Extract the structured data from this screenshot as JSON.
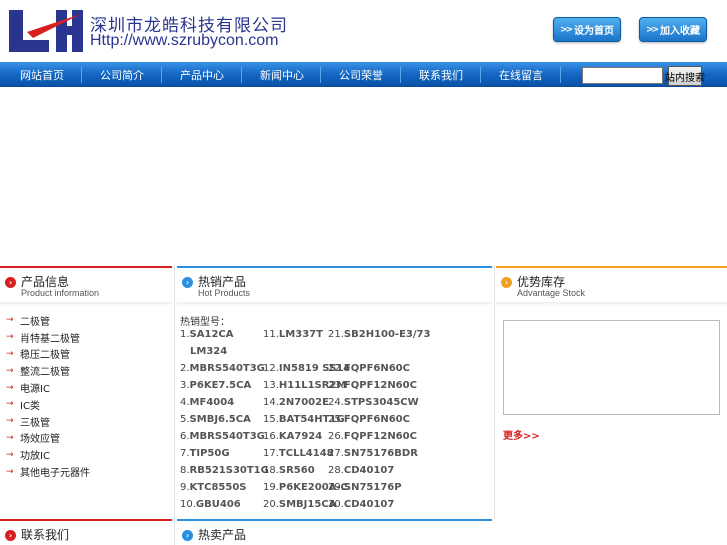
{
  "header": {
    "company_name": "深圳市龙皓科技有限公司",
    "url": "Http://www.szrubycon.com",
    "set_home_label": "设为首页",
    "add_favorite_label": "加入收藏",
    "logo_color": "#2a3590",
    "logo_accent": "#d6201f"
  },
  "nav": {
    "items": [
      "网站首页",
      "公司简介",
      "产品中心",
      "新闻中心",
      "公司荣誉",
      "联系我们",
      "在线留言"
    ],
    "search_button": "站内搜索"
  },
  "panels": {
    "product": {
      "title": "产品信息",
      "subtitle": "Product information"
    },
    "hot": {
      "title": "热销产品",
      "subtitle": "Hot Products"
    },
    "stock": {
      "title": "优势库存",
      "subtitle": "Advantage Stock"
    },
    "contact": {
      "title": "联系我们"
    },
    "hotsale": {
      "title": "热卖产品"
    }
  },
  "product_list": [
    "二极管",
    "肖特基二极管",
    "稳压二极管",
    "整流二极管",
    "电源IC",
    "IC类",
    "三极管",
    "场效应管",
    "功放IC",
    "其他电子元器件"
  ],
  "hot": {
    "label": "热销型号：",
    "rows": [
      [
        [
          "1.",
          "SA12CA"
        ],
        [
          "11.",
          "LM337T"
        ],
        [
          "21.",
          "SB2H100-E3/73"
        ]
      ],
      [
        [
          "",
          "LM324"
        ]
      ],
      [
        [
          "2.",
          "MBRS540T3G"
        ],
        [
          "12.",
          "IN5819 SS14"
        ],
        [
          "22.",
          "FQPF6N60C"
        ]
      ],
      [
        [
          "3.",
          "P6KE7.5CA"
        ],
        [
          "13.",
          "H11L1SR2M"
        ],
        [
          "23.",
          "FQPF12N60C"
        ]
      ],
      [
        [
          "4.",
          "MF4004"
        ],
        [
          "14.",
          "2N7002E"
        ],
        [
          "24.",
          "STPS3045CW"
        ]
      ],
      [
        [
          "5.",
          "SMBJ6.5CA"
        ],
        [
          "15.",
          "BAT54HT1G"
        ],
        [
          "25.",
          "FQPF6N60C"
        ]
      ],
      [
        [
          "6.",
          "MBRS540T3G"
        ],
        [
          "16.",
          "KA7924"
        ],
        [
          "26.",
          "FQPF12N60C"
        ]
      ],
      [
        [
          "7.",
          "TIP50G"
        ],
        [
          "17.",
          "TCLL4148"
        ],
        [
          "27.",
          "SN75176BDR"
        ]
      ],
      [
        [
          "8.",
          "RB521S30T1G"
        ],
        [
          "18.",
          "SR560"
        ],
        [
          "28.",
          "CD40107"
        ]
      ],
      [
        [
          "9.",
          "KTC8550S"
        ],
        [
          "19.",
          "P6KE200A-C"
        ],
        [
          "29.",
          "SN75176P"
        ]
      ],
      [
        [
          "10.",
          "GBU406"
        ],
        [
          "20.",
          "SMBJ15CA"
        ],
        [
          "30.",
          "CD40107"
        ]
      ]
    ]
  },
  "stock": {
    "more_label": "更多>>"
  },
  "colors": {
    "nav_blue": "#1468c4",
    "red_accent": "#d6201f",
    "blue_accent": "#2b8fe0",
    "orange_accent": "#f0a020"
  }
}
